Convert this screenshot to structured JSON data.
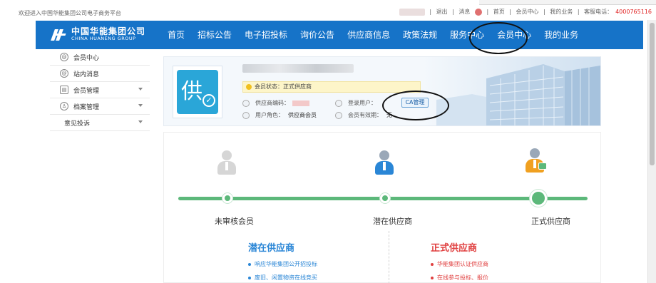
{
  "topbar": {
    "welcome": "欢迎进入中国华能集团公司电子商务平台",
    "logout": "退出",
    "message": "消息",
    "links": [
      "首页",
      "会员中心",
      "我的业务"
    ],
    "hotline_label": "客服电话：",
    "hotline": "4000765116",
    "separator": "|"
  },
  "logo": {
    "cn": "中国华能集团公司",
    "en": "CHINA HUANENG GROUP"
  },
  "nav": [
    "首页",
    "招标公告",
    "电子招投标",
    "询价公告",
    "供应商信息",
    "政策法规",
    "服务中心",
    "会员中心",
    "我的业务"
  ],
  "sidebar": [
    {
      "label": "会员中心",
      "icon": "member-icon",
      "caret": false
    },
    {
      "label": "站内消息",
      "icon": "message-icon",
      "caret": false
    },
    {
      "label": "会员管理",
      "icon": "id-card-icon",
      "caret": true
    },
    {
      "label": "档案管理",
      "icon": "user-archive-icon",
      "caret": true
    },
    {
      "label": "意见投诉",
      "icon": "",
      "caret": true
    }
  ],
  "profile": {
    "avatar_text": "供",
    "status_label": "会员状态：",
    "status_value": "正式供应商",
    "supplier_code_label": "供应商编码：",
    "login_user_label": "登录用户：",
    "role_label": "用户角色：",
    "role_value": "供应商会员",
    "validity_label": "会员有效期：",
    "validity_value": "无",
    "ca_button": "CA管理"
  },
  "progress": {
    "steps": [
      {
        "label": "未审核会员",
        "state": "inactive"
      },
      {
        "label": "潜在供应商",
        "state": "done"
      },
      {
        "label": "正式供应商",
        "state": "current"
      }
    ],
    "level": 1.0
  },
  "columns": {
    "potential": {
      "title": "潜在供应商",
      "items": [
        "响应华能集团公开招投标",
        "废旧、闲置物资在线竞买"
      ]
    },
    "formal": {
      "title": "正式供应商",
      "items": [
        "华能集团认证供应商",
        "在线参与投标、报价"
      ]
    }
  },
  "colors": {
    "nav_blue": "#1673c8",
    "progress_green": "#5cb87a",
    "accent_blue": "#2a86d6",
    "accent_red": "#e04040"
  }
}
